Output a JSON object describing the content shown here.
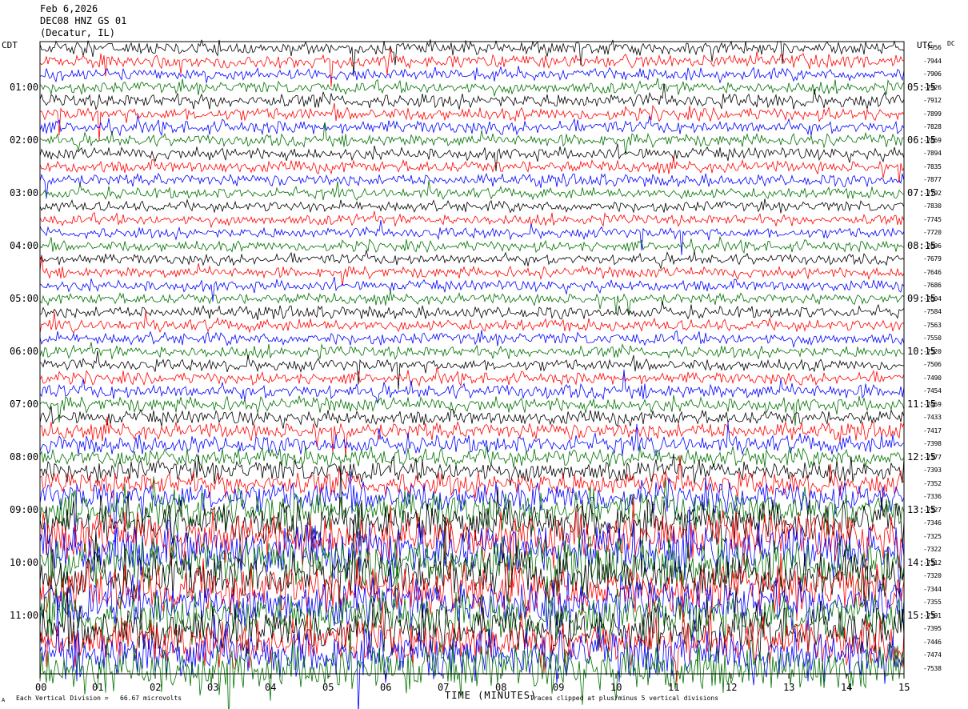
{
  "header": {
    "date": "Feb 6,2026",
    "station": "DEC08 HNZ GS 01",
    "location": "(Decatur, IL)"
  },
  "left_axis_title": "CDT",
  "right_axis_title": "UTC",
  "dc_title": "DC",
  "cdt_labels": [
    "01:00",
    "02:00",
    "03:00",
    "04:00",
    "05:00",
    "06:00",
    "07:00",
    "08:00",
    "09:00",
    "10:00",
    "11:00"
  ],
  "utc_labels": [
    "05:15",
    "06:15",
    "07:15",
    "08:15",
    "09:15",
    "10:15",
    "11:15",
    "12:15",
    "13:15",
    "14:15",
    "15:15"
  ],
  "dc_offsets": [
    "-7956",
    "-7944",
    "-7906",
    "-7926",
    "-7912",
    "-7899",
    "-7828",
    "-7869",
    "-7894",
    "-7835",
    "-7877",
    "-7792",
    "-7830",
    "-7745",
    "-7720",
    "-7696",
    "-7679",
    "-7646",
    "-7686",
    "-7604",
    "-7584",
    "-7563",
    "-7550",
    "-7520",
    "-7506",
    "-7490",
    "-7454",
    "-7459",
    "-7433",
    "-7417",
    "-7398",
    "-7377",
    "-7393",
    "-7352",
    "-7336",
    "-7327",
    "-7346",
    "-7325",
    "-7322",
    "-7312",
    "-7320",
    "-7344",
    "-7355",
    "-7391",
    "-7395",
    "-7446",
    "-7474",
    "-7538"
  ],
  "x_axis": {
    "tick_labels": [
      "00",
      "01",
      "02",
      "03",
      "04",
      "05",
      "06",
      "07",
      "08",
      "09",
      "10",
      "11",
      "12",
      "13",
      "14",
      "15"
    ],
    "title": "TIME (MINUTES)"
  },
  "footer": {
    "left": "Each Vertical Division =   66.67 microvolts",
    "right": "Traces clipped at plus/minus 5 vertical divisions",
    "corner": "A"
  },
  "colors": {
    "trace_cycle": [
      "#000000",
      "#ff0000",
      "#0000ff",
      "#007000"
    ],
    "background": "#ffffff"
  },
  "chart_data": {
    "type": "line",
    "title": "",
    "xlabel": "TIME (MINUTES)",
    "ylabel": "",
    "xlim": [
      0,
      15
    ],
    "trace_count": 48,
    "trace_duration_minutes": 15,
    "start_time_cdt": "00:15",
    "activity_profile": [
      0.55,
      0.55,
      0.5,
      0.5,
      0.6,
      0.55,
      0.55,
      0.5,
      0.5,
      0.5,
      0.5,
      0.45,
      0.45,
      0.45,
      0.45,
      0.45,
      0.45,
      0.45,
      0.45,
      0.45,
      0.5,
      0.5,
      0.5,
      0.5,
      0.5,
      0.5,
      0.6,
      0.6,
      0.6,
      0.7,
      0.75,
      0.8,
      0.9,
      1.0,
      1.3,
      1.6,
      1.8,
      2.0,
      2.1,
      2.1,
      2.1,
      2.1,
      2.0,
      2.0,
      2.0,
      2.0,
      2.0,
      2.0
    ]
  }
}
